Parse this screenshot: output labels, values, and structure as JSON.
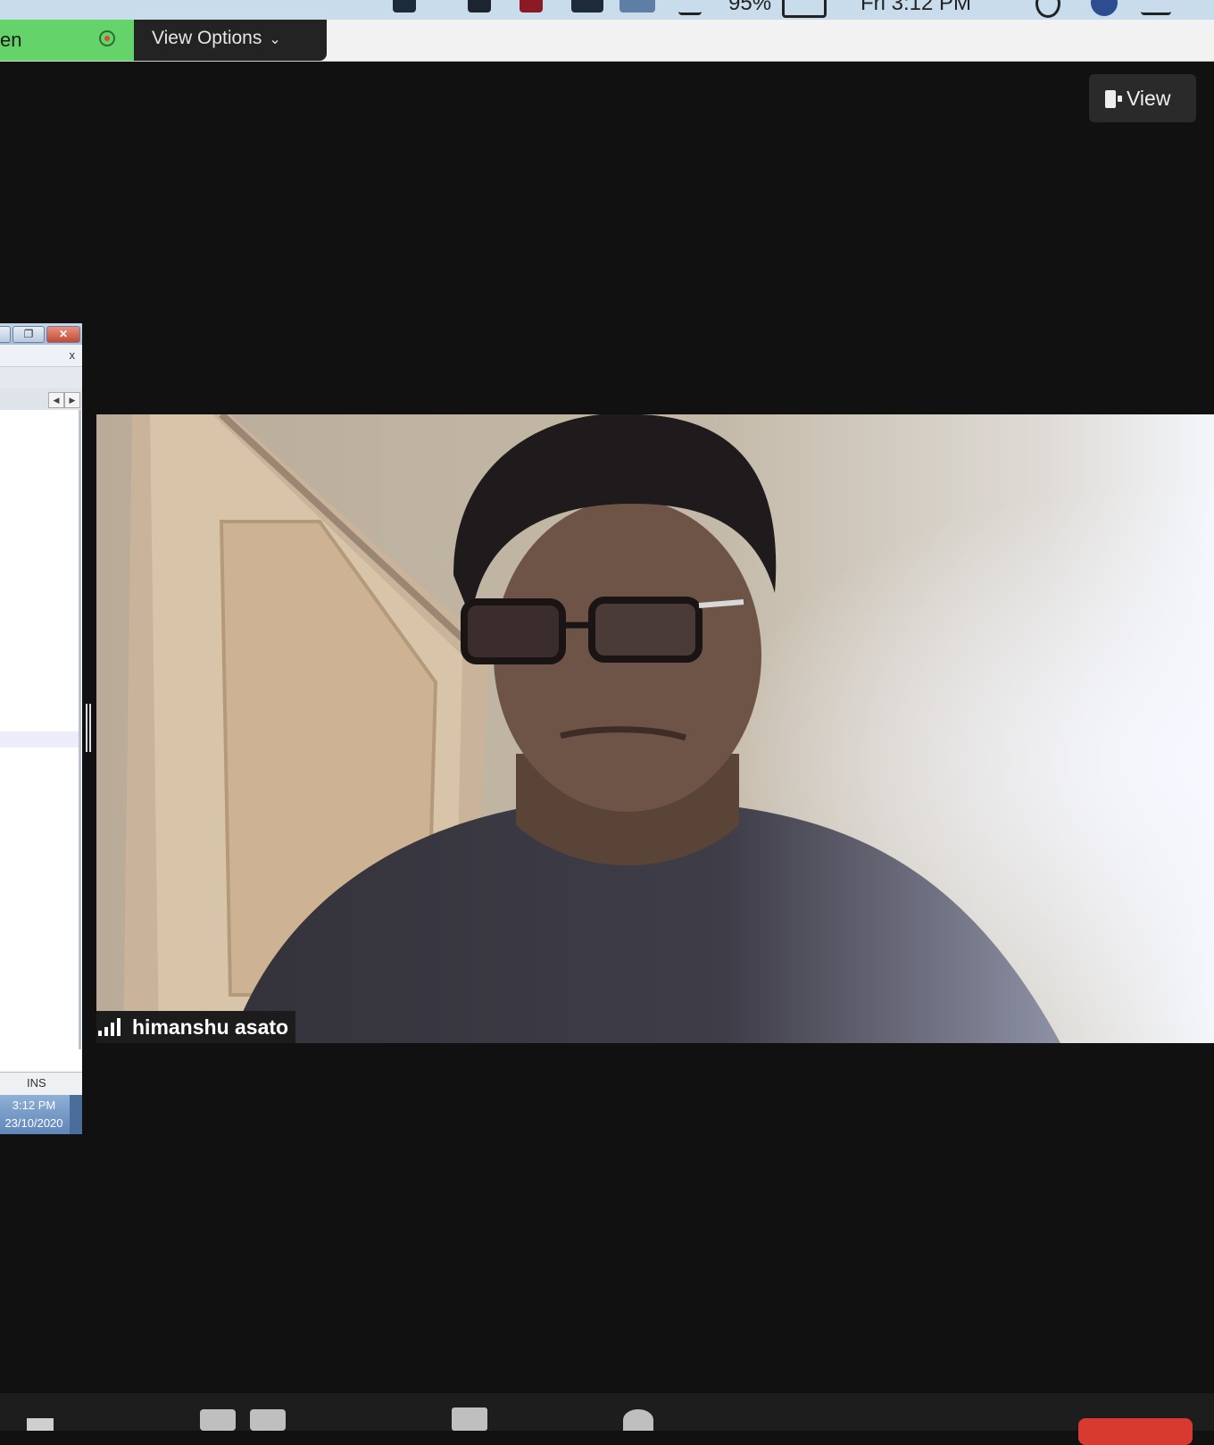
{
  "menubar": {
    "battery": "95%",
    "clock": "Fri 3:12 PM",
    "icons": [
      "zoom-icon",
      "dropbox-icon",
      "shield-icon",
      "user-status-icon",
      "lock-icon",
      "wifi-icon",
      "battery-icon",
      "search-icon",
      "siri-icon",
      "list-icon"
    ]
  },
  "topbar": {
    "share_label": "en",
    "view_options_label": "View Options",
    "share_color": "#63d36a"
  },
  "view_button": {
    "label": "View"
  },
  "windows_app": {
    "close_label": "x",
    "status_ins": "INS",
    "time": "3:12 PM",
    "date": "23/10/2020"
  },
  "participant": {
    "name": "himanshu asato"
  },
  "colors": {
    "background": "#111111",
    "end_button": "#d83a2f"
  }
}
